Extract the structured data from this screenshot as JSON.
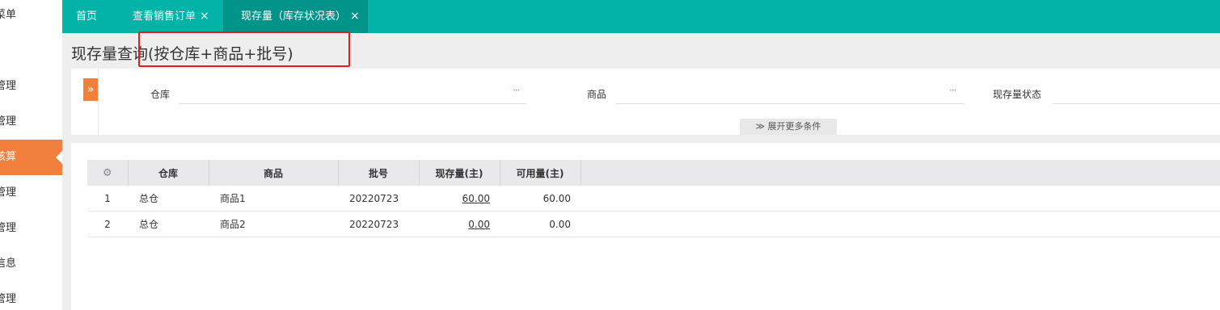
{
  "sidebar": {
    "items": [
      {
        "label": "菜单"
      },
      {
        "label": "管理"
      },
      {
        "label": "管理"
      },
      {
        "label": "核算"
      },
      {
        "label": "管理"
      },
      {
        "label": "管理"
      },
      {
        "label": "信息"
      },
      {
        "label": "管理"
      }
    ]
  },
  "tabs": [
    {
      "label": "首页"
    },
    {
      "label": "查看销售订单",
      "close": "×"
    },
    {
      "label": "现存量（库存状况表）",
      "close": "×"
    }
  ],
  "page": {
    "title": "现存量查询(按仓库+商品+批号)"
  },
  "filters": {
    "toggle": "»",
    "warehouse_label": "仓库",
    "product_label": "商品",
    "status_label": "现存量状态",
    "dots": "···",
    "more": "≫ 展开更多条件"
  },
  "table": {
    "settings_icon": "⚙",
    "columns": [
      "仓库",
      "商品",
      "批号",
      "现存量(主)",
      "可用量(主)"
    ],
    "rows": [
      {
        "index": "1",
        "warehouse": "总仓",
        "product": "商品1",
        "batch": "20220723",
        "onhand": "60.00",
        "available": "60.00"
      },
      {
        "index": "2",
        "warehouse": "总仓",
        "product": "商品2",
        "batch": "20220723",
        "onhand": "0.00",
        "available": "0.00"
      }
    ]
  },
  "colors": {
    "tab_bar": "#03b3a7",
    "accent": "#f0803c",
    "highlight": "#e02020"
  }
}
